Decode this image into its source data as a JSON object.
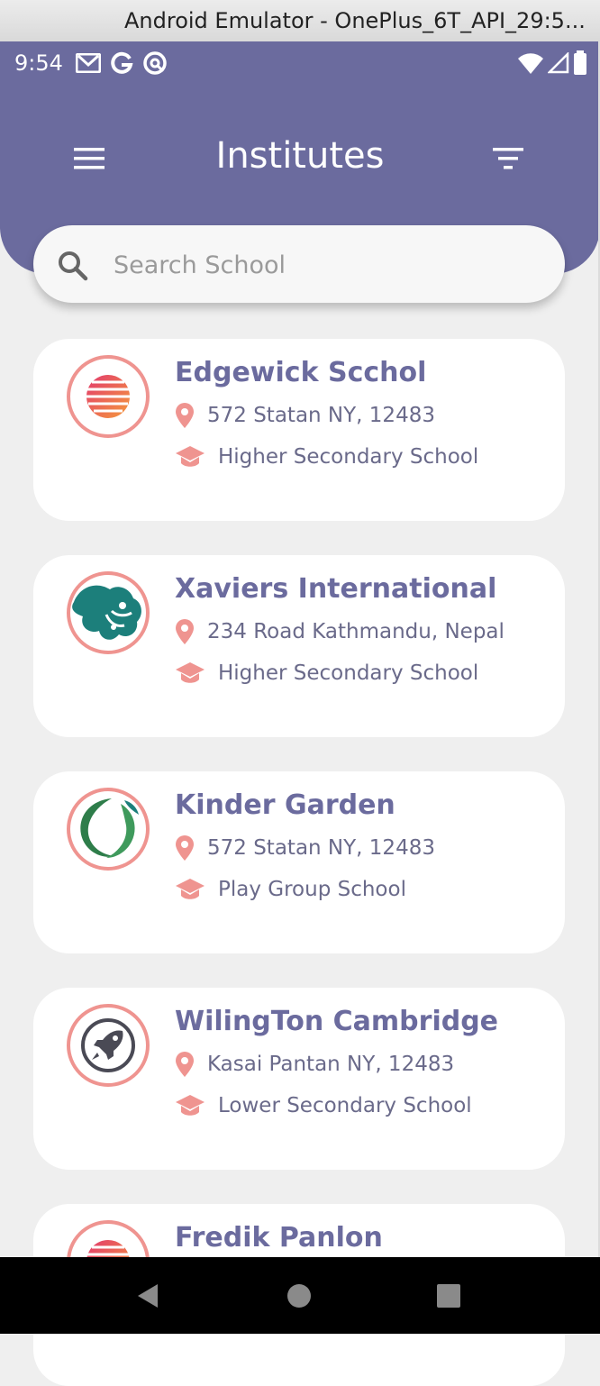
{
  "window": {
    "title": "Android Emulator - OnePlus_6T_API_29:5..."
  },
  "status_bar": {
    "time": "9:54"
  },
  "app_bar": {
    "title": "Institutes"
  },
  "search": {
    "placeholder": "Search School",
    "value": ""
  },
  "institutes": [
    {
      "name": "Edgewick Scchol",
      "address": "572 Statan NY, 12483",
      "type": "Higher Secondary School",
      "logo": "striped-globe-logo"
    },
    {
      "name": "Xaviers International",
      "address": "234 Road Kathmandu, Nepal",
      "type": "Higher Secondary School",
      "logo": "tree-logo"
    },
    {
      "name": "Kinder Garden",
      "address": "572 Statan NY, 12483",
      "type": "Play Group School",
      "logo": "leaf-swirl-logo"
    },
    {
      "name": "WilingTon Cambridge",
      "address": "Kasai Pantan NY, 12483",
      "type": "Lower Secondary School",
      "logo": "rocket-logo"
    },
    {
      "name": "Fredik Panlon",
      "address": "",
      "type": "",
      "logo": "striped-globe-logo"
    }
  ],
  "colors": {
    "primary": "#6b6b9e",
    "accent": "#ef9490",
    "background": "#efefef"
  },
  "icons": {
    "location": "location-pin-icon",
    "type": "graduation-cap-icon",
    "search": "search-icon",
    "menu": "hamburger-menu-icon",
    "filter": "filter-icon"
  }
}
